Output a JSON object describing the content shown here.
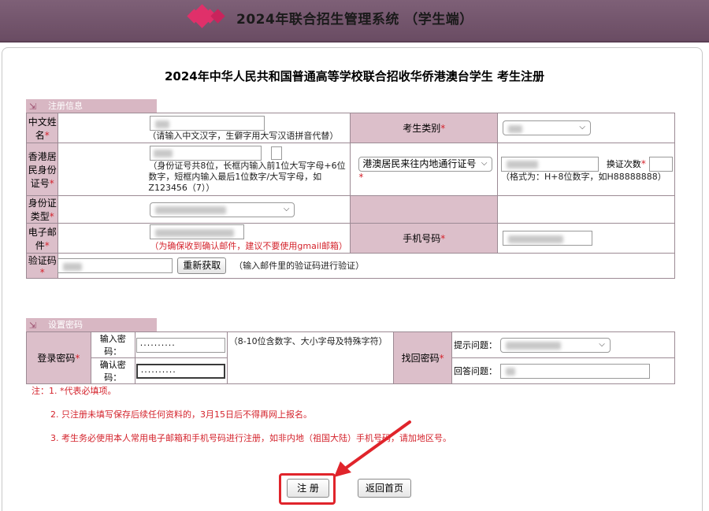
{
  "app": {
    "title": "2024年联合招生管理系统 （学生端）"
  },
  "page": {
    "title": "2024年中华人民共和国普通高等学校联合招收华侨港澳台学生  考生注册"
  },
  "colors": {
    "header": "#6f5069",
    "label_bg": "#dcbfca",
    "required": "#d4232c",
    "highlight": "#e0242b"
  },
  "registration": {
    "section_label": "注册信息",
    "chinese_name": {
      "label": "中文姓名",
      "hint": "（请输入中文汉字，生僻字用大写汉语拼音代替）"
    },
    "candidate_type": {
      "label": "考生类别"
    },
    "hk_id": {
      "label": "香港居民身份证号",
      "check_digit_hint": "（）",
      "hint": "（身份证号共8位，长框内输入前1位大写字母+6位数字，短框内输入最后1位数字/大写字母，如Z123456（7））"
    },
    "permit": {
      "selected": "港澳居民来往内地通行证号",
      "renewal_label": "换证次数",
      "format_hint": "（格式为：H+8位数字，如H88888888）"
    },
    "id_type": {
      "label": "身份证类型"
    },
    "email": {
      "label": "电子邮件",
      "hint": "（为确保收到确认邮件，建议不要使用gmail邮箱）"
    },
    "phone": {
      "label": "手机号码"
    },
    "code": {
      "label": "验证码",
      "resend_button": "重新获取",
      "hint": "（输入邮件里的验证码进行验证）"
    }
  },
  "password": {
    "section_label": "设置密码",
    "login_label": "登录密码",
    "enter_label": "输入密码：",
    "confirm_label": "确认密码：",
    "enter_value": "··········",
    "confirm_value": "··········",
    "rule_hint": "（8-10位含数字、大小字母及特殊字符）",
    "recover_label": "找回密码",
    "question_label": "提示问题：",
    "answer_label": "回答问题："
  },
  "notes": {
    "n1": "注：1. *代表必填项。",
    "n2": "2. 只注册未填写保存后续任何资料的，3月15日后不得再网上报名。",
    "n3": "3. 考生务必使用本人常用电子邮箱和手机号码进行注册，如非内地（祖国大陆）手机号码，请加地区号。"
  },
  "buttons": {
    "register": "注 册",
    "back_home": "返回首页"
  }
}
